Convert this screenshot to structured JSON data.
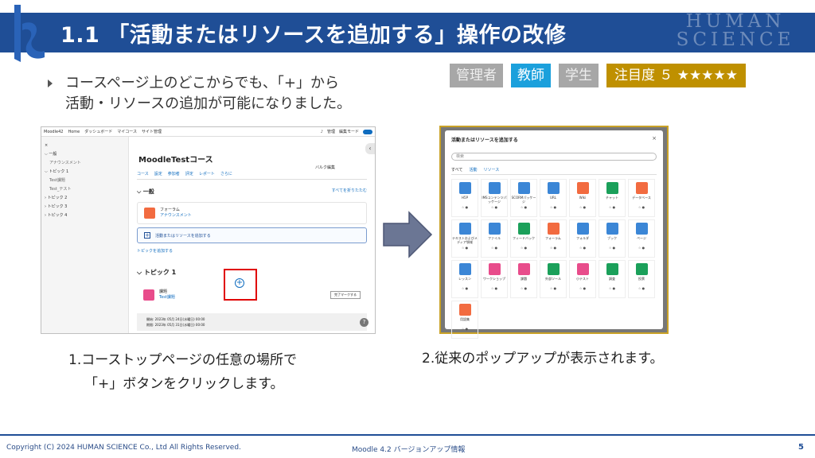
{
  "header": {
    "title": "1.1 「活動またはリソースを追加する」操作の改修",
    "logo_line1": "HUMAN",
    "logo_line2": "SCIENCE"
  },
  "tags": {
    "admin": "管理者",
    "teacher": "教師",
    "student": "学生",
    "attention": "注目度 ５ ★★★★★"
  },
  "bullet": {
    "line1": "コースページ上のどこからでも、「+」から",
    "line2": "活動・リソースの追加が可能になりました。"
  },
  "screenshot1": {
    "nav": [
      "Moodle42",
      "Home",
      "ダッシュボード",
      "マイコース",
      "サイト管理"
    ],
    "edit_mode": "編集モード",
    "user": "管理",
    "sidebar": [
      {
        "label": "一般",
        "type": "section"
      },
      {
        "label": "アナウンスメント",
        "type": "sub"
      },
      {
        "label": "トピック 1",
        "type": "section"
      },
      {
        "label": "Test課題",
        "type": "sub"
      },
      {
        "label": "Test_テスト",
        "type": "sub"
      },
      {
        "label": "トピック 2",
        "type": "section"
      },
      {
        "label": "トピック 3",
        "type": "section"
      },
      {
        "label": "トピック 4",
        "type": "section"
      }
    ],
    "course_title": "MoodleTestコース",
    "course_edit": "バルク編集",
    "tabs": [
      "コース",
      "設定",
      "参加者",
      "評定",
      "レポート",
      "さらに"
    ],
    "section_general": "一般",
    "collapse_all": "すべてを折りたたむ",
    "forum_name": "フォーラム",
    "forum_sub": "アナウンスメント",
    "add_resource": "活動またはリソースを追加する",
    "add_topic": "トピックを追加する",
    "topic1": "トピック 1",
    "assign_type": "課題",
    "assign_name": "Test課題",
    "mark_done": "完了マークする",
    "date_open": "開始: 2023年 05月 24日(水曜日) 00:00",
    "date_due": "期限: 2023年 05月 31日(水曜日) 00:00",
    "plus_symbol": "+"
  },
  "screenshot2": {
    "title": "活動またはリソースを追加する",
    "search_placeholder": "検索",
    "tabs": [
      "すべて",
      "活動",
      "リソース"
    ],
    "items": [
      {
        "label": "H5P",
        "color": "#3b86d6"
      },
      {
        "label": "IMSコンテンツパッケージ",
        "color": "#3b86d6"
      },
      {
        "label": "SCORMパッケージ",
        "color": "#3b86d6"
      },
      {
        "label": "URL",
        "color": "#3b86d6"
      },
      {
        "label": "Wiki",
        "color": "#f26b40"
      },
      {
        "label": "チャット",
        "color": "#1ba05a"
      },
      {
        "label": "データベース",
        "color": "#f26b40"
      },
      {
        "label": "テキストおよびメディア領域",
        "color": "#3b86d6"
      },
      {
        "label": "ファイル",
        "color": "#3b86d6"
      },
      {
        "label": "フィードバック",
        "color": "#1ba05a"
      },
      {
        "label": "フォーラム",
        "color": "#f26b40"
      },
      {
        "label": "フォルダ",
        "color": "#3b86d6"
      },
      {
        "label": "ブック",
        "color": "#3b86d6"
      },
      {
        "label": "ページ",
        "color": "#3b86d6"
      },
      {
        "label": "レッスン",
        "color": "#3b86d6"
      },
      {
        "label": "ワークショップ",
        "color": "#e84c8b"
      },
      {
        "label": "課題",
        "color": "#e84c8b"
      },
      {
        "label": "外部ツール",
        "color": "#1ba05a"
      },
      {
        "label": "小テスト",
        "color": "#e84c8b"
      },
      {
        "label": "調査",
        "color": "#1ba05a"
      },
      {
        "label": "投票",
        "color": "#1ba05a"
      },
      {
        "label": "用語集",
        "color": "#f26b40"
      }
    ]
  },
  "captions": {
    "step1_line1": "1.コーストップページの任意の場所で",
    "step1_line2": "「+」ボタンをクリックします。",
    "step2": "2.従来のポップアップが表示されます。"
  },
  "footer": {
    "copyright": "Copyright (C) 2024 HUMAN SCIENCE Co., Ltd All Rights Reserved.",
    "doc_title": "Moodle 4.2 バージョンアップ情報",
    "page": "5"
  },
  "colors": {
    "banner": "#1f4e96",
    "tag_gray": "#a7a7a7",
    "tag_blue": "#1ba0dc",
    "tag_gold": "#bf9000",
    "highlight": "#e00000"
  }
}
